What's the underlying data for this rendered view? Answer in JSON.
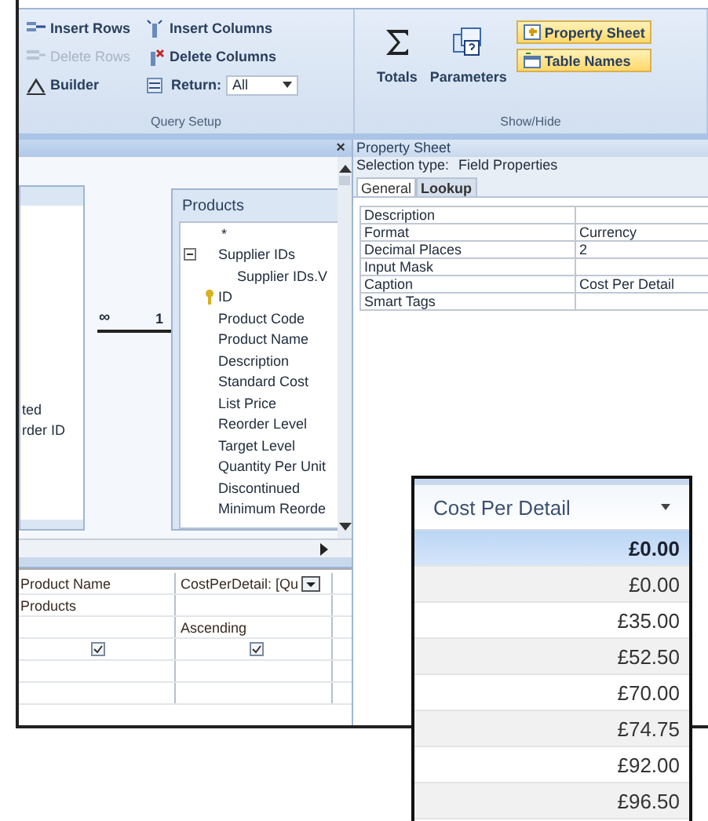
{
  "ribbon": {
    "query_setup": {
      "label": "Query Setup",
      "buttons": [
        {
          "label": "Insert Rows",
          "disabled": false
        },
        {
          "label": "Delete Rows",
          "disabled": true
        },
        {
          "label": "Builder",
          "disabled": false
        },
        {
          "label": "Insert Columns",
          "disabled": false
        },
        {
          "label": "Delete Columns",
          "disabled": false
        }
      ],
      "return_field": {
        "label": "Return:",
        "value": "All"
      }
    },
    "show_hide": {
      "label": "Show/Hide",
      "large_buttons": [
        {
          "label": "Totals"
        },
        {
          "label": "Parameters"
        }
      ],
      "toggles": [
        {
          "label": "Property Sheet",
          "on": true
        },
        {
          "label": "Table Names",
          "on": true
        }
      ]
    }
  },
  "query_design": {
    "close": "×",
    "left_table": {
      "fields": [
        "ted",
        "rder ID"
      ]
    },
    "relationship": {
      "many": "∞",
      "one": "1"
    },
    "products_table": {
      "title": "Products",
      "fields": [
        {
          "label": "*",
          "kind": "all"
        },
        {
          "label": "Supplier IDs",
          "kind": "multi",
          "expanded": true,
          "children": [
            {
              "label": "Supplier IDs.V"
            }
          ]
        },
        {
          "label": "ID",
          "kind": "key"
        },
        {
          "label": "Product Code",
          "kind": "plain"
        },
        {
          "label": "Product Name",
          "kind": "plain"
        },
        {
          "label": "Description",
          "kind": "plain"
        },
        {
          "label": "Standard Cost",
          "kind": "plain"
        },
        {
          "label": "List Price",
          "kind": "plain"
        },
        {
          "label": "Reorder Level",
          "kind": "plain"
        },
        {
          "label": "Target Level",
          "kind": "plain"
        },
        {
          "label": "Quantity Per Unit",
          "kind": "plain"
        },
        {
          "label": "Discontinued",
          "kind": "plain"
        },
        {
          "label": "Minimum Reorde",
          "kind": "plain"
        }
      ]
    }
  },
  "design_grid": {
    "columns": [
      {
        "field": "Product Name",
        "table": "Products",
        "show": true,
        "dropdown": false
      },
      {
        "field": "CostPerDetail: [Qu",
        "sort": "Ascending",
        "show": true,
        "dropdown": true
      }
    ]
  },
  "property_sheet": {
    "title": "Property Sheet",
    "selection_label": "Selection type:",
    "selection_value": "Field Properties",
    "tabs": [
      {
        "label": "General",
        "selected": true
      },
      {
        "label": "Lookup",
        "selected": false
      }
    ],
    "rows": [
      {
        "name": "Description"
      },
      {
        "name": "Format",
        "value": "Currency"
      },
      {
        "name": "Decimal Places",
        "value": "2"
      },
      {
        "name": "Input Mask"
      },
      {
        "name": "Caption",
        "value": "Cost Per Detail"
      },
      {
        "name": "Smart Tags"
      }
    ]
  },
  "datasheet": {
    "header": "Cost Per Detail",
    "rows": [
      {
        "value": "£0.00",
        "selected": true
      },
      {
        "value": "£0.00",
        "selected": false
      },
      {
        "value": "£35.00",
        "selected": false
      },
      {
        "value": "£52.50",
        "selected": false
      },
      {
        "value": "£70.00",
        "selected": false
      },
      {
        "value": "£74.75",
        "selected": false
      },
      {
        "value": "£92.00",
        "selected": false
      },
      {
        "value": "£96.50",
        "selected": false
      }
    ]
  }
}
